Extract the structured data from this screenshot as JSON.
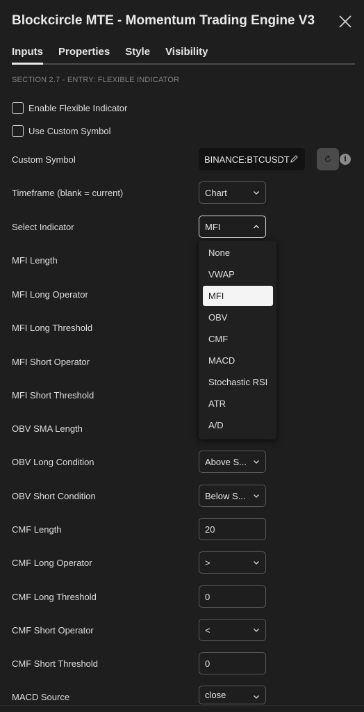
{
  "dialog": {
    "title": "Blockcircle MTE - Momentum Trading Engine V3"
  },
  "tabs": [
    {
      "label": "Inputs",
      "active": true
    },
    {
      "label": "Properties",
      "active": false
    },
    {
      "label": "Style",
      "active": false
    },
    {
      "label": "Visibility",
      "active": false
    }
  ],
  "section_heading": "SECTION 2.7 - ENTRY: FLEXIBLE INDICATOR",
  "checkboxes": [
    {
      "label": "Enable Flexible Indicator",
      "checked": false
    },
    {
      "label": "Use Custom Symbol",
      "checked": false
    }
  ],
  "rows": {
    "custom_symbol": {
      "label": "Custom Symbol",
      "value": "BINANCE:BTCUSDT"
    },
    "timeframe": {
      "label": "Timeframe (blank = current)",
      "value": "Chart"
    },
    "select_indicator": {
      "label": "Select Indicator",
      "value": "MFI"
    },
    "mfi_length": {
      "label": "MFI Length"
    },
    "mfi_long_operator": {
      "label": "MFI Long Operator"
    },
    "mfi_long_threshold": {
      "label": "MFI Long Threshold"
    },
    "mfi_short_operator": {
      "label": "MFI Short Operator"
    },
    "mfi_short_threshold": {
      "label": "MFI Short Threshold"
    },
    "obv_sma_length": {
      "label": "OBV SMA Length"
    },
    "obv_long_condition": {
      "label": "OBV Long Condition",
      "value": "Above S..."
    },
    "obv_short_condition": {
      "label": "OBV Short Condition",
      "value": "Below S..."
    },
    "cmf_length": {
      "label": "CMF Length",
      "value": "20"
    },
    "cmf_long_operator": {
      "label": "CMF Long Operator",
      "value": ">"
    },
    "cmf_long_threshold": {
      "label": "CMF Long Threshold",
      "value": "0"
    },
    "cmf_short_operator": {
      "label": "CMF Short Operator",
      "value": "<"
    },
    "cmf_short_threshold": {
      "label": "CMF Short Threshold",
      "value": "0"
    },
    "macd_source": {
      "label": "MACD Source",
      "value": "close"
    }
  },
  "indicator_dropdown": {
    "options": [
      "None",
      "VWAP",
      "MFI",
      "OBV",
      "CMF",
      "MACD",
      "Stochastic RSI",
      "ATR",
      "A/D"
    ],
    "selected": "MFI"
  },
  "icons": {
    "close": "close-icon",
    "pencil": "pencil-icon",
    "reset": "reset-icon",
    "info": "info-icon",
    "chevron": "chevron-down-icon"
  }
}
